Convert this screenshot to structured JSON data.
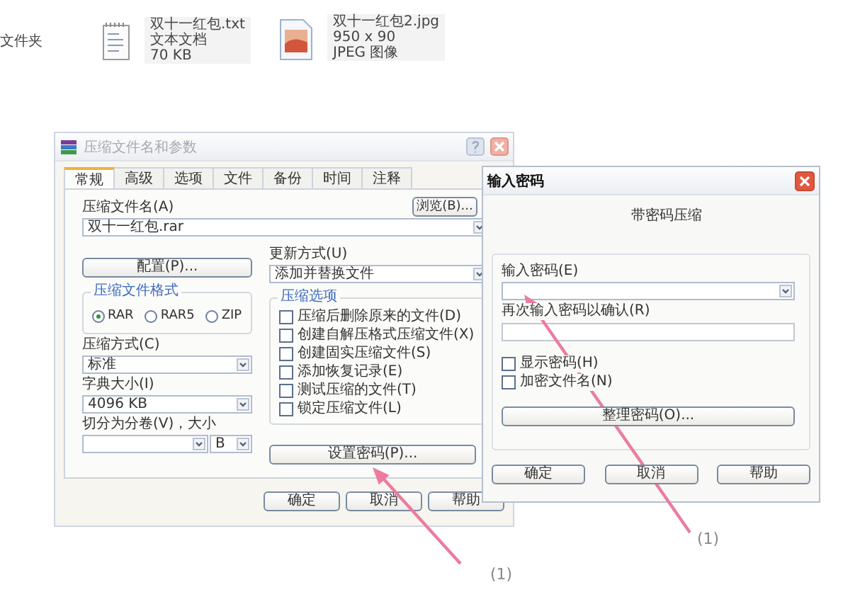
{
  "desktop_items": [
    {
      "kind": "folder",
      "lines": [
        "文件夹"
      ]
    },
    {
      "kind": "text",
      "lines": [
        "双十一红包.txt",
        "文本文档",
        "70 KB"
      ]
    },
    {
      "kind": "image",
      "lines": [
        "双十一红包2.jpg",
        "950 x 90",
        "JPEG 图像"
      ]
    }
  ],
  "archive_dialog": {
    "title": "压缩文件名和参数",
    "tabs": [
      {
        "label": "常规",
        "selected": true
      },
      {
        "label": "高级",
        "selected": false
      },
      {
        "label": "选项",
        "selected": false
      },
      {
        "label": "文件",
        "selected": false
      },
      {
        "label": "备份",
        "selected": false
      },
      {
        "label": "时间",
        "selected": false
      },
      {
        "label": "注释",
        "selected": false
      }
    ],
    "archive_name_label": "压缩文件名(A)",
    "browse_button": "浏览(B)...",
    "archive_name": "双十一红包.rar",
    "update_mode_label": "更新方式(U)",
    "update_mode": "添加并替换文件",
    "profiles_button": "配置(P)...",
    "format_group": {
      "title": "压缩文件格式",
      "options": [
        {
          "label": "RAR",
          "selected": true
        },
        {
          "label": "RAR5",
          "selected": false
        },
        {
          "label": "ZIP",
          "selected": false
        }
      ]
    },
    "method_label": "压缩方式(C)",
    "method": "标准",
    "dictionary_label": "字典大小(I)",
    "dictionary": "4096 KB",
    "split_label": "切分为分卷(V)，大小",
    "split_unit": "B",
    "options_group": {
      "title": "压缩选项",
      "items": [
        {
          "label": "压缩后删除原来的文件(D)",
          "checked": false
        },
        {
          "label": "创建自解压格式压缩文件(X)",
          "checked": false
        },
        {
          "label": "创建固实压缩文件(S)",
          "checked": false
        },
        {
          "label": "添加恢复记录(E)",
          "checked": false
        },
        {
          "label": "测试压缩的文件(T)",
          "checked": false
        },
        {
          "label": "锁定压缩文件(L)",
          "checked": false
        }
      ]
    },
    "password_button": "设置密码(P)...",
    "buttons": [
      "确定",
      "取消",
      "帮助"
    ]
  },
  "password_dialog": {
    "title": "输入密码",
    "heading": "带密码压缩",
    "enter_label": "输入密码(E)",
    "confirm_label": "再次输入密码以确认(R)",
    "checkboxes": [
      {
        "label": "显示密码(H)",
        "checked": false
      },
      {
        "label": "加密文件名(N)",
        "checked": false
      }
    ],
    "organize_button": "整理密码(O)...",
    "buttons": [
      "确定",
      "取消",
      "帮助"
    ]
  },
  "annotations": [
    {
      "label": "(1)"
    },
    {
      "label": "(1)"
    }
  ]
}
